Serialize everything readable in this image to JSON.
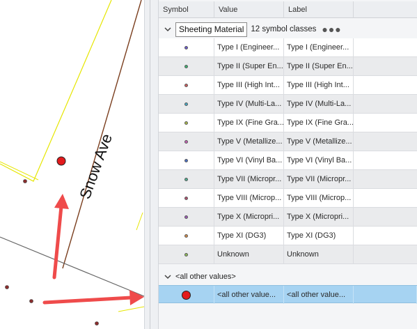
{
  "map": {
    "street_label": "Snow Ave",
    "colors": {
      "parcel_line": "#e6e600",
      "street_line": "#7a3e1e",
      "road_line": "#666666",
      "arrow": "#ef4b4b",
      "point": "#8b2e2e",
      "selected_point": "#e31a1c"
    }
  },
  "table": {
    "headers": {
      "symbol": "Symbol",
      "value": "Value",
      "label": "Label"
    },
    "group": {
      "field": "Sheeting Material",
      "count": "12 symbol classes",
      "more": "●●●"
    },
    "rows": [
      {
        "value": "Type I (Engineer...",
        "label": "Type I (Engineer...",
        "color": "#6a5acd"
      },
      {
        "value": "Type II (Super En...",
        "label": "Type II (Super En...",
        "color": "#3cb371"
      },
      {
        "value": "Type III (High Int...",
        "label": "Type III (High Int...",
        "color": "#cd5c5c"
      },
      {
        "value": "Type IV (Multi-La...",
        "label": "Type IV (Multi-La...",
        "color": "#48a9c5"
      },
      {
        "value": "Type IX (Fine Gra...",
        "label": "Type IX (Fine Gra...",
        "color": "#a8b84a"
      },
      {
        "value": "Type V (Metallize...",
        "label": "Type V (Metallize...",
        "color": "#c45fb4"
      },
      {
        "value": "Type VI (Vinyl Ba...",
        "label": "Type VI (Vinyl Ba...",
        "color": "#4a6fc4"
      },
      {
        "value": "Type VII (Micropr...",
        "label": "Type VII (Micropr...",
        "color": "#4caf90"
      },
      {
        "value": "Type VIII (Microp...",
        "label": "Type VIII (Microp...",
        "color": "#b0506e"
      },
      {
        "value": "Type X (Micropri...",
        "label": "Type X (Micropri...",
        "color": "#9b59b6"
      },
      {
        "value": "Type XI (DG3)",
        "label": "Type XI (DG3)",
        "color": "#d08a4a"
      },
      {
        "value": "Unknown",
        "label": "Unknown",
        "color": "#8fbc5a"
      }
    ],
    "other": {
      "group_label": "<all other values>",
      "value": "<all other value...",
      "label": "<all other value...",
      "color": "#e31a1c"
    }
  }
}
